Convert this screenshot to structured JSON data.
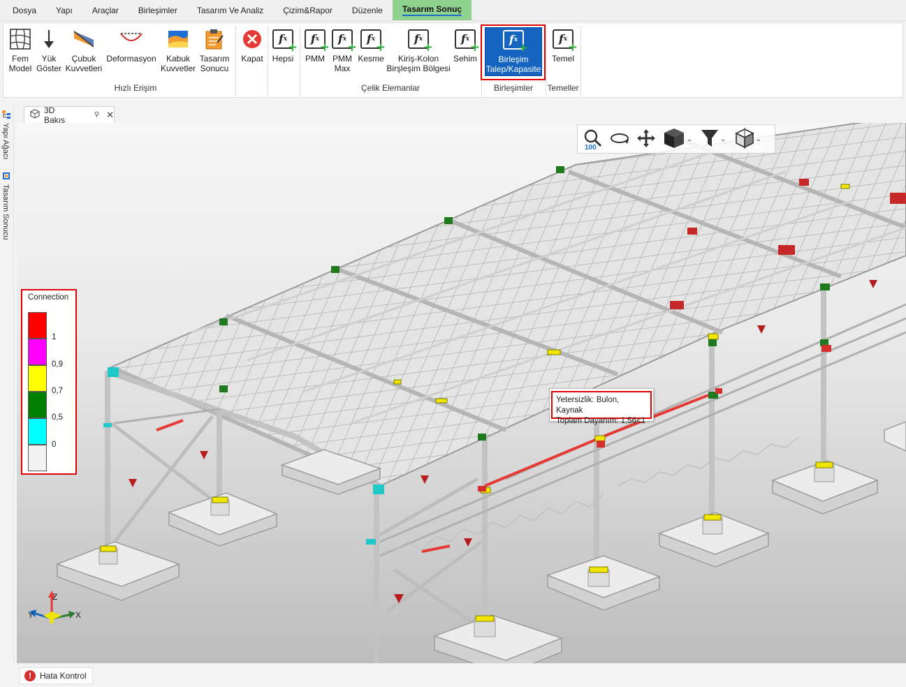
{
  "menu": [
    "Dosya",
    "Yapı",
    "Araçlar",
    "Birleşimler",
    "Tasarım Ve Analiz",
    "Çizim&Rapor",
    "Düzenle",
    "Tasarım Sonuç"
  ],
  "active_menu": "Tasarım Sonuç",
  "ribbon": {
    "quick": {
      "label": "Hızlı Erişim",
      "fem": [
        "Fem",
        "Model"
      ],
      "yuk": [
        "Yük",
        "Göster"
      ],
      "cubuk": [
        "Çubuk",
        "Kuvvetleri"
      ],
      "deform": "Deformasyon",
      "kabuk": [
        "Kabuk",
        "Kuvvetler"
      ],
      "tasarim": [
        "Tasarım",
        "Sonucu"
      ],
      "kapat": "Kapat"
    },
    "all": "Hepsi",
    "steel": {
      "label": "Çelik Elemanlar",
      "pmm": "PMM",
      "pmm_max": [
        "PMM",
        "Max"
      ],
      "kesme": "Kesme",
      "kiris": [
        "Kiriş-Kolon",
        "Birşleşim Bölgesi"
      ],
      "sehim": "Sehim"
    },
    "connections": {
      "label": "Birleşimler",
      "button": [
        "Birleşim",
        "Talep/Kapasite"
      ]
    },
    "foundations": {
      "label": "Temeller",
      "button": "Temel"
    }
  },
  "side_tabs": [
    "Yapı Ağacı",
    "Tasarım Sonucu"
  ],
  "doc_tab": {
    "label": "3D Bakış"
  },
  "view_toolbar": {
    "zoom": "100"
  },
  "legend": {
    "title": "Connection",
    "colors": [
      "#ff0000",
      "#ff00ff",
      "#ffff00",
      "#008000",
      "#00ffff",
      "#f2f2f2"
    ],
    "values": [
      "1",
      "0,9",
      "0,7",
      "0,5",
      "0"
    ]
  },
  "tooltip": {
    "line1": "Yetersizlik: Bulon, Kaynak",
    "line2": "Toplam Dayanım: 1,56<1"
  },
  "axes": {
    "x": "X",
    "y": "Y",
    "z": "Z"
  },
  "status": {
    "error_button": "Hata Kontrol"
  }
}
